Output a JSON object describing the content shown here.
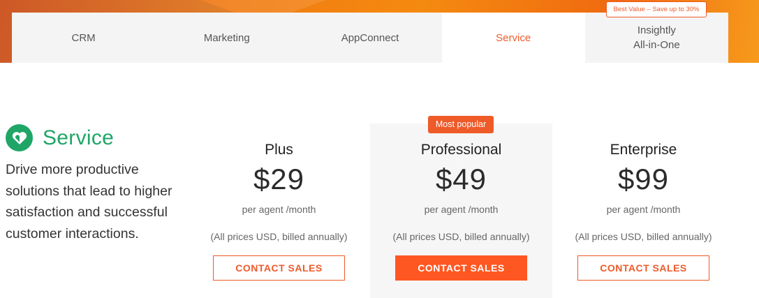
{
  "tabs": [
    {
      "label": "CRM",
      "active": false
    },
    {
      "label": "Marketing",
      "active": false
    },
    {
      "label": "AppConnect",
      "active": false
    },
    {
      "label": "Service",
      "active": true
    },
    {
      "label_line1": "Insightly",
      "label_line2": "All-in-One",
      "active": false
    }
  ],
  "best_value_badge": "Best Value – Save up to 30%",
  "product": {
    "name": "Service",
    "icon": "heart-icon",
    "description": "Drive more productive solutions that lead to higher satisfaction and successful customer interactions."
  },
  "popular_badge": "Most popular",
  "plans": [
    {
      "name": "Plus",
      "price": "$29",
      "per": "per agent /month",
      "note": "(All prices USD, billed annually)",
      "cta": "CONTACT SALES"
    },
    {
      "name": "Professional",
      "price": "$49",
      "per": "per agent /month",
      "note": "(All prices USD, billed annually)",
      "cta": "CONTACT SALES"
    },
    {
      "name": "Enterprise",
      "price": "$99",
      "per": "per agent /month",
      "note": "(All prices USD, billed annually)",
      "cta": "CONTACT SALES"
    }
  ],
  "colors": {
    "accent": "#ef5a29",
    "brand_green": "#1fa667"
  }
}
